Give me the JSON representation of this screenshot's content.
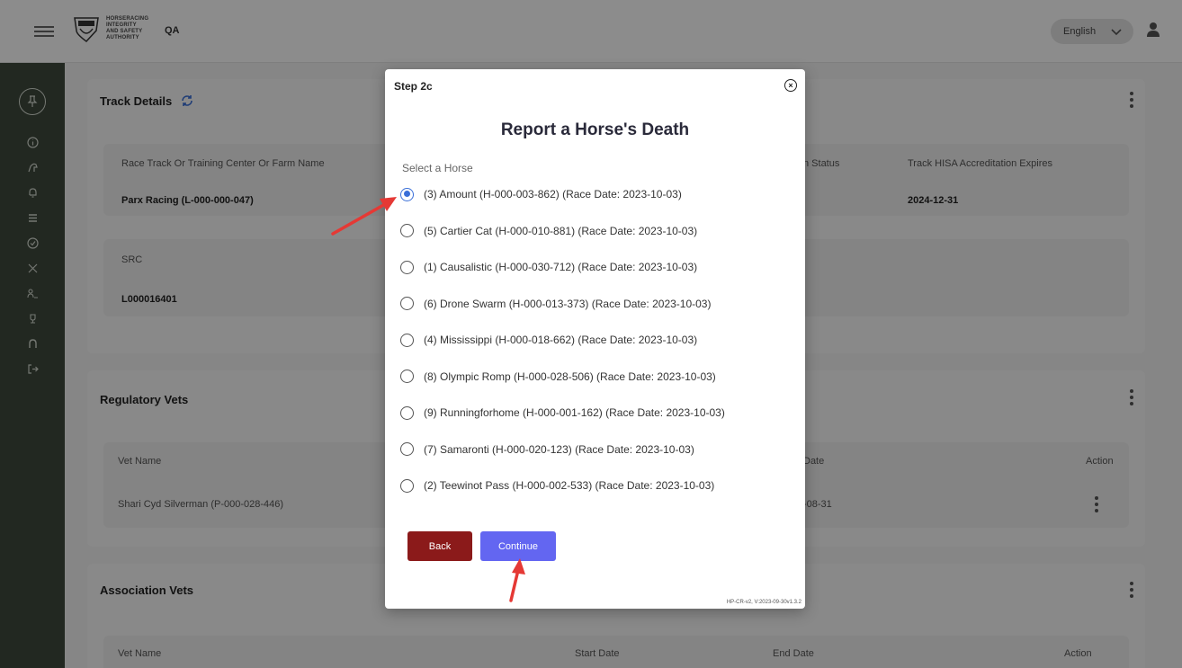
{
  "header": {
    "logo_lines": [
      "HORSERACING",
      "INTEGRITY",
      "AND SAFETY",
      "AUTHORITY"
    ],
    "env_label": "QA",
    "language": "English"
  },
  "track_details": {
    "title": "Track Details",
    "columns": [
      "Race Track Or Training Center Or Farm Name",
      "n Status",
      "Track HISA Accreditation Expires"
    ],
    "values": [
      "Parx Racing (L-000-000-047)",
      "",
      "2024-12-31"
    ],
    "src_label": "SRC",
    "src_value": "L000016401"
  },
  "regulatory_vets": {
    "title": "Regulatory Vets",
    "columns": [
      "Vet Name",
      "Date",
      "Action"
    ],
    "row": [
      "Shari Cyd Silverman (P-000-028-446)",
      "-08-31"
    ]
  },
  "association_vets": {
    "title": "Association Vets",
    "columns": [
      "Vet Name",
      "Start Date",
      "End Date",
      "Action"
    ]
  },
  "modal": {
    "step": "Step 2c",
    "close_symbol": "×",
    "title": "Report a Horse's Death",
    "select_label": "Select a Horse",
    "horses": [
      {
        "label": "(3) Amount (H-000-003-862) (Race Date: 2023-10-03)",
        "checked": true
      },
      {
        "label": "(5) Cartier Cat (H-000-010-881) (Race Date: 2023-10-03)",
        "checked": false
      },
      {
        "label": "(1) Causalistic (H-000-030-712) (Race Date: 2023-10-03)",
        "checked": false
      },
      {
        "label": "(6) Drone Swarm (H-000-013-373) (Race Date: 2023-10-03)",
        "checked": false
      },
      {
        "label": "(4) Mississippi (H-000-018-662) (Race Date: 2023-10-03)",
        "checked": false
      },
      {
        "label": "(8) Olympic Romp (H-000-028-506) (Race Date: 2023-10-03)",
        "checked": false
      },
      {
        "label": "(9) Runningforhome (H-000-001-162) (Race Date: 2023-10-03)",
        "checked": false
      },
      {
        "label": "(7) Samaronti (H-000-020-123) (Race Date: 2023-10-03)",
        "checked": false
      },
      {
        "label": "(2) Teewinot Pass (H-000-002-533) (Race Date: 2023-10-03)",
        "checked": false
      }
    ],
    "back_label": "Back",
    "continue_label": "Continue",
    "version": "HP-CR-v2, V:2023-09-30v1.3.2"
  },
  "colors": {
    "sidebar": "#3e4a3c",
    "back_button": "#8b1a1a",
    "continue_button": "#6366f1",
    "radio_checked": "#3a6fd8",
    "annotation_arrow": "#e53935"
  },
  "icons": {
    "menu": "hamburger-icon",
    "refresh": "refresh-icon",
    "user": "user-icon",
    "close": "close-icon"
  }
}
